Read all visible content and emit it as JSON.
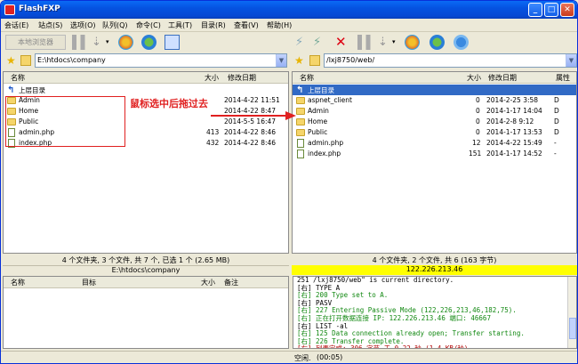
{
  "window": {
    "title": "FlashFXP"
  },
  "menu": [
    "会话(E)",
    "站点(S)",
    "选项(O)",
    "队列(Q)",
    "命令(C)",
    "工具(T)",
    "目录(R)",
    "查看(V)",
    "帮助(H)"
  ],
  "toolbar": {
    "local_browser": "本地浏览器"
  },
  "left": {
    "path": "E:\\htdocs\\company",
    "col_name": "名称",
    "col_size": "大小",
    "col_date": "修改日期",
    "up": "上层目录",
    "files": [
      {
        "name": "Admin",
        "size": "",
        "date": "2014-4-22 11:51",
        "type": "folder"
      },
      {
        "name": "Home",
        "size": "",
        "date": "2014-4-22 8:47",
        "type": "folder"
      },
      {
        "name": "Public",
        "size": "",
        "date": "2014-5-5 16:47",
        "type": "folder"
      },
      {
        "name": "admin.php",
        "size": "413",
        "date": "2014-4-22 8:46",
        "type": "file"
      },
      {
        "name": "index.php",
        "size": "432",
        "date": "2014-4-22 8:46",
        "type": "file"
      }
    ],
    "status": "4 个文件夹, 3 个文件, 共 7 个, 已选 1 个 (2.65 MB)",
    "path_status": "E:\\htdocs\\company"
  },
  "right": {
    "path": "/lxj8750/web/",
    "col_name": "名称",
    "col_size": "大小",
    "col_date": "修改日期",
    "col_attr": "属性",
    "up": "上层目录",
    "files": [
      {
        "name": "aspnet_client",
        "size": "0",
        "date": "2014-2-25 3:58",
        "attr": "D",
        "type": "folder"
      },
      {
        "name": "Admin",
        "size": "0",
        "date": "2014-1-17 14:04",
        "attr": "D",
        "type": "folder"
      },
      {
        "name": "Home",
        "size": "0",
        "date": "2014-2-8 9:12",
        "attr": "D",
        "type": "folder"
      },
      {
        "name": "Public",
        "size": "0",
        "date": "2014-1-17 13:53",
        "attr": "D",
        "type": "folder"
      },
      {
        "name": "admin.php",
        "size": "12",
        "date": "2014-4-22 15:49",
        "attr": "-",
        "type": "file"
      },
      {
        "name": "index.php",
        "size": "151",
        "date": "2014-1-17 14:52",
        "attr": "-",
        "type": "file"
      }
    ],
    "status": "4 个文件夹, 2 个文件, 共 6 (163 字节)",
    "ip": "122.226.213.46"
  },
  "queue": {
    "col_name": "名称",
    "col_target": "目标",
    "col_size": "大小",
    "col_note": "备注"
  },
  "annotation": "鼠标选中后拖过去",
  "log": [
    {
      "t": "251 /lxj8750/web\" is current directory.",
      "c": "#000"
    },
    {
      "t": "[右] TYPE A",
      "c": "#000"
    },
    {
      "t": "[右] 200 Type set to A.",
      "c": "#118811"
    },
    {
      "t": "[右] PASV",
      "c": "#000"
    },
    {
      "t": "[右] 227 Entering Passive Mode (122,226,213,46,182,75).",
      "c": "#118811"
    },
    {
      "t": "[右] 正在打开数据连接 IP: 122.226.213.46 端口: 46667",
      "c": "#118811"
    },
    {
      "t": "[右] LIST -al",
      "c": "#000"
    },
    {
      "t": "[右] 125 Data connection already open; Transfer starting.",
      "c": "#118811"
    },
    {
      "t": "[右] 226 Transfer complete.",
      "c": "#118811"
    },
    {
      "t": "[右] 列表完成: 306 字节 于 0.22 秒 (1.4 KB/秒)",
      "c": "#b00000"
    }
  ],
  "statusbar": {
    "idle": "空闲.",
    "time": "(00:05)"
  },
  "colors": {
    "selection": "#316ac5",
    "ip_bg": "#ffff00",
    "annotation": "#e02020"
  }
}
